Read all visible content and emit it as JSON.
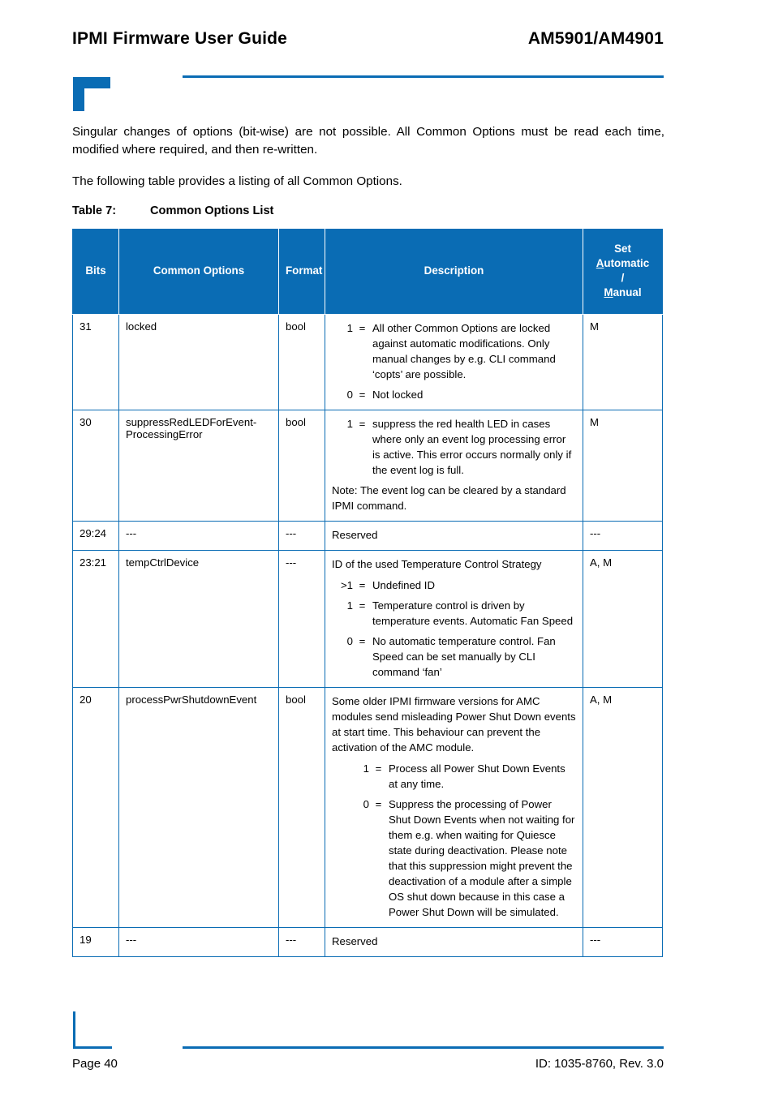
{
  "colors": {
    "brand_blue": "#0a6cb4",
    "header_text": "#ffffff",
    "body_text": "#000000"
  },
  "running_header": {
    "left_title": "IPMI Firmware User Guide",
    "right_title": "AM5901/AM4901"
  },
  "body": {
    "paragraph_1": "Singular changes of options (bit-wise) are not possible. All Common Options must be read each time, modified where required, and then re-written.",
    "paragraph_2": "The following table provides a listing of all Common Options."
  },
  "table_caption": {
    "number": "Table 7:",
    "title": "Common Options List"
  },
  "table": {
    "columns": [
      {
        "key": "bits",
        "label": "Bits"
      },
      {
        "key": "name",
        "label": "Common Options"
      },
      {
        "key": "format",
        "label": "Format"
      },
      {
        "key": "desc",
        "label": "Description"
      },
      {
        "key": "set",
        "label_line_1": "Set",
        "label_line_2_a": "A",
        "label_line_2_b": "utomatic",
        "label_line_3": "/",
        "label_line_4_a": "M",
        "label_line_4_b": "anual"
      }
    ],
    "rows": [
      {
        "bits": "31",
        "name": "locked",
        "format": "bool",
        "set": "M",
        "desc_blocks": [
          {
            "type": "kv",
            "key": "1",
            "eq": "=",
            "value": "All other Common Options are locked against automatic modifications. Only manual changes by e.g. CLI command ‘copts’ are possible."
          },
          {
            "type": "kv",
            "key": "0",
            "eq": "=",
            "value": "Not locked"
          }
        ]
      },
      {
        "bits": "30",
        "name": "suppressRedLEDForEvent-ProcessingError",
        "format": "bool",
        "set": "M",
        "desc_blocks": [
          {
            "type": "kv",
            "key": "1",
            "eq": "=",
            "value": "suppress the red health LED in cases where only an event log processing error is active. This error occurs normally only if the event log is full."
          },
          {
            "type": "note",
            "value": "Note: The event log can be cleared by a standard IPMI command."
          }
        ]
      },
      {
        "bits": "29:24",
        "name": "---",
        "format": "---",
        "set": "---",
        "desc_blocks": [
          {
            "type": "lead",
            "value": "Reserved"
          }
        ]
      },
      {
        "bits": "23:21",
        "name": "tempCtrlDevice",
        "format": "---",
        "set": "A, M",
        "desc_blocks": [
          {
            "type": "lead",
            "value": "ID of the used Temperature Control Strategy"
          },
          {
            "type": "kv",
            "key": ">1",
            "eq": "=",
            "value": "Undefined ID"
          },
          {
            "type": "kv",
            "key": "1",
            "eq": "=",
            "value": "Temperature control is driven by temperature events. Automatic Fan Speed"
          },
          {
            "type": "kv",
            "key": "0",
            "eq": "=",
            "value": "No automatic temperature control. Fan Speed can be set manually by CLI command ‘fan’"
          }
        ]
      },
      {
        "bits": "20",
        "name": "processPwrShutdownEvent",
        "format": "bool",
        "set": "A, M",
        "desc_blocks": [
          {
            "type": "lead",
            "value": "Some older IPMI firmware versions for AMC modules send misleading Power Shut Down events at start time. This behaviour can prevent the activation of the AMC module."
          },
          {
            "type": "kv-indent",
            "key": "1",
            "eq": "=",
            "value": "Process all Power Shut Down Events at any time."
          },
          {
            "type": "kv-indent",
            "key": "0",
            "eq": "=",
            "value": "Suppress the processing of Power Shut Down Events when not waiting for them e.g. when waiting for Quiesce state during deactivation. Please note that this suppression might prevent the deactivation of a module after a simple OS shut down because in this case a Power Shut Down will be simulated."
          }
        ]
      },
      {
        "bits": "19",
        "name": "---",
        "format": "---",
        "set": "---",
        "desc_blocks": [
          {
            "type": "lead",
            "value": "Reserved"
          }
        ]
      }
    ]
  },
  "running_footer": {
    "page_label": "Page 40",
    "document_id": "ID: 1035-8760, Rev. 3.0"
  }
}
